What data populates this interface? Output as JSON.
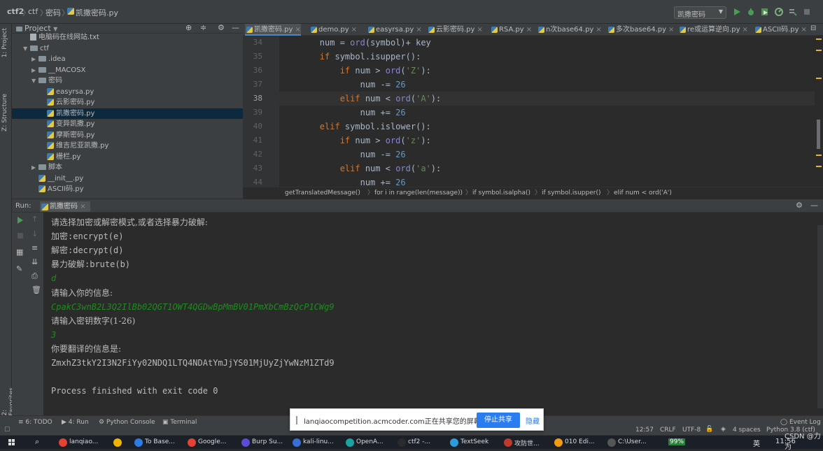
{
  "nav": {
    "crumbs": [
      "ctf2",
      "ctf",
      "密码",
      "凯撒密码.py"
    ],
    "run_config": "凯撒密码"
  },
  "left_strip": {
    "project": "1: Project",
    "structure": "Z: Structure",
    "favorites": "2: Favorites"
  },
  "project": {
    "header": "Project",
    "items": [
      {
        "label": "电脑码在线网站.txt",
        "type": "txt",
        "indent": 1,
        "arrow": ""
      },
      {
        "label": "ctf",
        "type": "folder",
        "indent": 1,
        "arrow": "▼"
      },
      {
        "label": ".idea",
        "type": "folder",
        "indent": 2,
        "arrow": "▶"
      },
      {
        "label": "__MACOSX",
        "type": "folder",
        "indent": 2,
        "arrow": "▶"
      },
      {
        "label": "密码",
        "type": "folder",
        "indent": 2,
        "arrow": "▼"
      },
      {
        "label": "easyrsa.py",
        "type": "py",
        "indent": 3,
        "arrow": ""
      },
      {
        "label": "云影密码.py",
        "type": "py",
        "indent": 3,
        "arrow": ""
      },
      {
        "label": "凯撒密码.py",
        "type": "py",
        "indent": 3,
        "arrow": "",
        "selected": true
      },
      {
        "label": "变异凯撒.py",
        "type": "py",
        "indent": 3,
        "arrow": ""
      },
      {
        "label": "摩斯密码.py",
        "type": "py",
        "indent": 3,
        "arrow": ""
      },
      {
        "label": "维吉尼亚凯撒.py",
        "type": "py",
        "indent": 3,
        "arrow": ""
      },
      {
        "label": "栅栏.py",
        "type": "py",
        "indent": 3,
        "arrow": ""
      },
      {
        "label": "脚本",
        "type": "folder",
        "indent": 2,
        "arrow": "▶"
      },
      {
        "label": "__init__.py",
        "type": "py",
        "indent": 2,
        "arrow": ""
      },
      {
        "label": "ASCII码.py",
        "type": "py",
        "indent": 2,
        "arrow": ""
      }
    ]
  },
  "tabs": [
    "凯撒密码.py",
    "demo.py",
    "easyrsa.py",
    "云影密码.py",
    "RSA.py",
    "n次base64.py",
    "多次base64.py",
    "re或运算逆向.py",
    "ASCII码.py"
  ],
  "editor": {
    "line_numbers": [
      "34",
      "35",
      "36",
      "37",
      "38",
      "39",
      "40",
      "41",
      "42",
      "43",
      "44"
    ],
    "current_line": "38",
    "breadcrumb": [
      "getTranslatedMessage()",
      "for i in range(len(message))",
      "if symbol.isalpha()",
      "if symbol.isupper()",
      "elif num < ord('A')"
    ]
  },
  "run": {
    "label": "Run:",
    "tab": "凯撒密码",
    "console": [
      {
        "text": "请选择加密或解密模式,或者选择暴力破解:",
        "kind": "serif"
      },
      {
        "text": "加密:encrypt(e)",
        "kind": "mono"
      },
      {
        "text": "解密:decrypt(d)",
        "kind": "mono"
      },
      {
        "text": "暴力破解:brute(b)",
        "kind": "mono"
      },
      {
        "text": "d",
        "kind": "in"
      },
      {
        "text": "请输入你的信息:",
        "kind": "serif"
      },
      {
        "text": "CpakC3wnB2L3Q2IlBb02QGT1OWT4QGDwBpMmBV01PmXbCmBzQcP1CWg9",
        "kind": "in"
      },
      {
        "text": "请输入密钥数字(1-26)",
        "kind": "serif"
      },
      {
        "text": "3",
        "kind": "in"
      },
      {
        "text": "你要翻译的信息是:",
        "kind": "serif"
      },
      {
        "text": "ZmxhZ3tkY2I3N2FiYy02NDQ1LTQ4NDAtYmJjYS01MjUyZjYwNzM1ZTd9",
        "kind": "mono"
      },
      {
        "text": "",
        "kind": "mono"
      },
      {
        "text": "Process finished with exit code 0",
        "kind": "mono"
      }
    ]
  },
  "status": {
    "todo": "6: TODO",
    "run": "4: Run",
    "python_console": "Python Console",
    "terminal": "Terminal",
    "event_log": "Event Log",
    "position": "12:57",
    "line_sep": "CRLF",
    "encoding": "UTF-8",
    "indent": "4 spaces",
    "interpreter": "Python 3.8 (ctf)"
  },
  "share": {
    "message": "lanqiaocompetition.acmcoder.com正在共享您的屏幕。",
    "stop": "停止共享",
    "hide": "隐藏"
  },
  "taskbar": {
    "items": [
      "lanqiao...",
      "",
      "To Base...",
      "Google...",
      "Burp Su...",
      "kali-linu...",
      "OpenA...",
      "ctf2 -...",
      "TextSeek",
      "攻防世...",
      "010 Edi...",
      "C:\\User..."
    ],
    "battery": "99%",
    "ime": "英",
    "time": "11:56",
    "watermark": "CSDN @力为"
  },
  "colors": {
    "accent": "#4a88c7",
    "run_green": "#499c54",
    "input_green": "#1f8a1f",
    "share_blue": "#2a7cf0"
  }
}
